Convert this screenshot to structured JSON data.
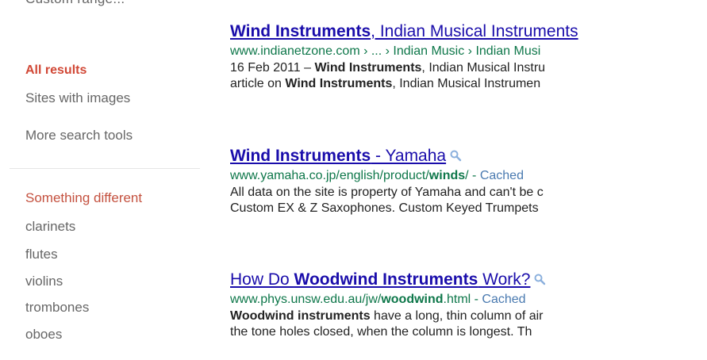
{
  "sidebar": {
    "cutoff_text": "Custom range...",
    "items": [
      {
        "label": "All results"
      },
      {
        "label": "Sites with images"
      },
      {
        "label": "More search tools"
      }
    ],
    "related_heading": "Something different",
    "related": [
      {
        "label": "clarinets"
      },
      {
        "label": "flutes"
      },
      {
        "label": "violins"
      },
      {
        "label": "trombones"
      },
      {
        "label": "oboes"
      }
    ]
  },
  "results": [
    {
      "title_bold": "Wind Instruments",
      "title_rest": ", Indian Musical Instruments",
      "url": "www.indianetzone.com › ... › Indian Music › Indian Musi",
      "snippet1_date": "16 Feb 2011 – ",
      "snippet1_bold": "Wind Instruments",
      "snippet1_rest": ", Indian Musical Instru",
      "snippet2_pre": "article on ",
      "snippet2_bold": "Wind Instruments",
      "snippet2_rest": ", Indian Musical Instrumen"
    },
    {
      "title_bold": "Wind Instruments",
      "title_rest": " - Yamaha",
      "url_pre": "www.yamaha.co.jp/english/product/",
      "url_bold": "winds",
      "url_post": "/ - ",
      "cached": "Cached",
      "snippet1": "All data on the site is property of Yamaha and can't be c",
      "snippet2": "Custom EX & Z Saxophones. Custom Keyed Trumpets"
    },
    {
      "title_pre": "How Do ",
      "title_bold": "Woodwind Instruments",
      "title_rest": " Work?",
      "url_pre": "www.phys.unsw.edu.au/jw/",
      "url_bold": "woodwind",
      "url_post": ".html - ",
      "cached": "Cached",
      "snippet1_bold": "Woodwind instruments",
      "snippet1_rest": " have a long, thin column of air",
      "snippet2": "the tone holes closed, when the column is longest. Th"
    }
  ],
  "icons": {
    "preview": "magnifier-icon"
  }
}
